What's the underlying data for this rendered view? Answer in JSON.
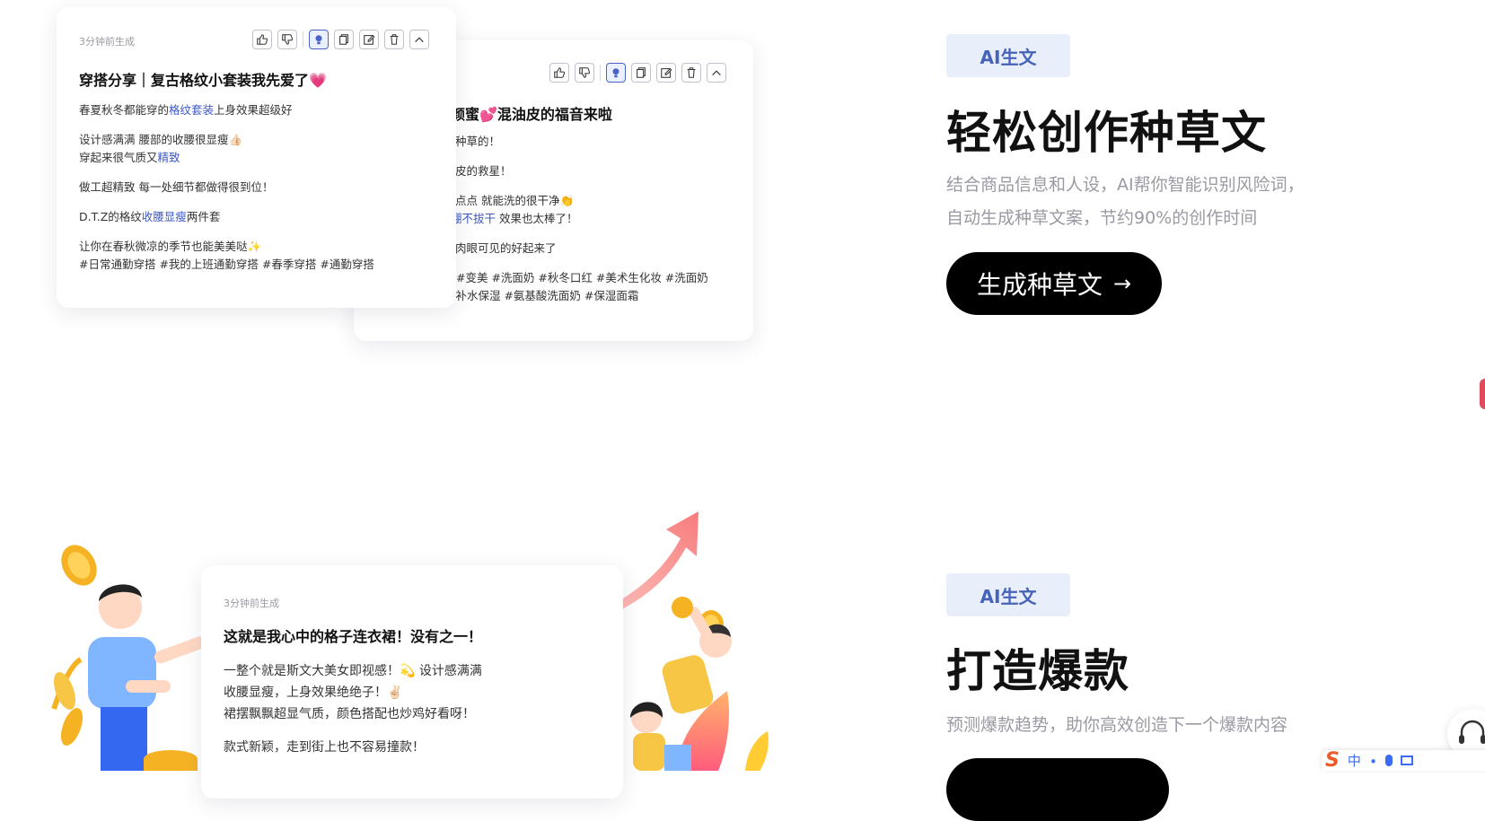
{
  "card1": {
    "meta": "3分钟前生成",
    "title": "穿搭分享｜复古格纹小套装我先爱了💗",
    "lines": [
      {
        "a": "春夏秋冬都能穿的",
        "b": "格纹套装",
        "c": "上身效果超级好"
      },
      {
        "a": "设计感满满 腰部的收腰很显瘦👍🏻",
        "b": "",
        "c": ""
      },
      {
        "a": "穿起来很气质又",
        "b": "精致",
        "c": ""
      },
      {
        "a": "做工超精致 每一处细节都做得很到位！",
        "b": "",
        "c": ""
      },
      {
        "a": "D.T.Z的格纹",
        "b": "收腰显瘦",
        "c": "两件套"
      },
      {
        "a": "让你在春秋微凉的季节也能美美哒✨",
        "b": "",
        "c": ""
      },
      {
        "a": "#日常通勤穿搭 #我的上班通勤穿搭 #春季穿搭 #通勤穿搭",
        "b": "",
        "c": ""
      }
    ]
  },
  "card2": {
    "title": "颜蜜💕混油皮的福音来啦",
    "lines": [
      {
        "a": "种草的！",
        "b": "",
        "c": ""
      },
      {
        "a": "皮的救星！",
        "b": "",
        "c": ""
      },
      {
        "a": "点点 就能洗的很干净👏",
        "b": "",
        "c": ""
      },
      {
        "a": "",
        "b": "绷不拔干",
        "c": " 效果也太棒了！"
      },
      {
        "a": "肉眼可见的好起来了",
        "b": "",
        "c": ""
      },
      {
        "a": "#变美 #洗面奶 #秋冬口红 #美术生化妆 #洗面奶",
        "b": "",
        "c": ""
      },
      {
        "a": "#补水保湿 #氨基酸洗面奶 #保湿面霜",
        "b": "",
        "c": ""
      }
    ]
  },
  "card3": {
    "meta": "3分钟前生成",
    "title": "这就是我心中的格子连衣裙！没有之一！",
    "lines": [
      {
        "a": "一整个就是斯文大美女即视感！💫 设计感满满"
      },
      {
        "a": "收腰显瘦，上身效果绝绝子！✌🏻"
      },
      {
        "a": "裙摆飘飘超显气质，颜色搭配也炒鸡好看呀！"
      },
      {
        "a": "款式新颖，走到街上也不容易撞款！"
      }
    ]
  },
  "section1": {
    "tag": "AI生文",
    "title": "轻松创作种草文",
    "desc1": "结合商品信息和人设，AI帮你智能识别风险词，",
    "desc2": "自动生成种草文案，节约90%的创作时间",
    "cta": "生成种草文",
    "cta_arrow": "→"
  },
  "section2": {
    "tag": "AI生文",
    "title": "打造爆款",
    "desc": "预测爆款趋势，助你高效创造下一个爆款内容"
  },
  "ime": {
    "logo": "S",
    "lang": "中"
  },
  "colors": {
    "accent": "#3d59c6",
    "tag_bg": "#e8eefa",
    "cta_bg": "#000000"
  }
}
